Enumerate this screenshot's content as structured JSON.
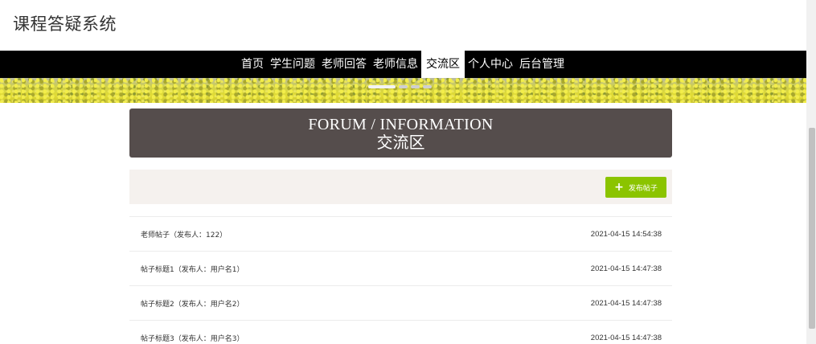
{
  "app": {
    "title": "课程答疑系统"
  },
  "nav": {
    "items": [
      {
        "label": "首页"
      },
      {
        "label": "学生问题"
      },
      {
        "label": "老师回答"
      },
      {
        "label": "老师信息"
      },
      {
        "label": "交流区",
        "active": true
      },
      {
        "label": "个人中心"
      },
      {
        "label": "后台管理"
      }
    ]
  },
  "banner": {
    "slides": 4,
    "active_slide": 0
  },
  "section": {
    "title_en": "FORUM / INFORMATION",
    "title_cn": "交流区"
  },
  "toolbar": {
    "post_button_label": "发布帖子",
    "post_button_icon": "plus-icon",
    "post_button_color": "#8bc400"
  },
  "posts": [
    {
      "title": "老师帖子（发布人：122）",
      "date": "2021-04-15 14:54:38"
    },
    {
      "title": "帖子标题1（发布人：用户名1）",
      "date": "2021-04-15 14:47:38"
    },
    {
      "title": "帖子标题2（发布人：用户名2）",
      "date": "2021-04-15 14:47:38"
    },
    {
      "title": "帖子标题3（发布人：用户名3）",
      "date": "2021-04-15 14:47:38"
    }
  ],
  "colors": {
    "navbar_bg": "#000000",
    "header_bg": "#554d4c",
    "toolbar_bg": "#f5f1ee"
  }
}
